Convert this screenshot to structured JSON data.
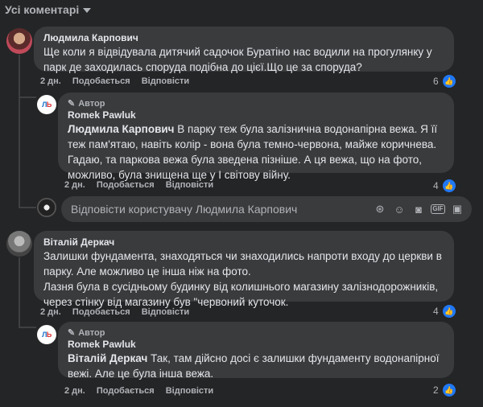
{
  "filter": {
    "label": "Усі коментарі"
  },
  "comments": [
    {
      "author": "Людмила Карпович",
      "text": "Ще коли я відвідувала дитячий садочок Буратіно нас водили на прогулянку у парк де заходилась споруда подібна до цієї.Що це за споруда?",
      "time": "2 дн.",
      "like": "Подобається",
      "reply": "Відповісти",
      "likes": "6"
    },
    {
      "author_badge": "Автор",
      "author": "Romek Pawluk",
      "mention": "Людмила Карпович",
      "text": " В парку теж була залізнична водонапірна вежа. Я її теж пам'ятаю, навіть колір - вона була темно-червона, майже коричнева.",
      "text2": "Гадаю, та паркова вежа була зведена пізніше. А ця вежа, що на фото, можливо, була знищена ще у І світову війну.",
      "time": "2 дн.",
      "like": "Подобається",
      "reply": "Відповісти",
      "likes": "4"
    },
    {
      "author": "Віталій Деркач",
      "text": "Залишки фундамента, знаходяться чи знаходились напроти входу до церкви в парку. Але можливо це інша ніж на фото.",
      "text2": "Лазня була в сусідньому будинку від колишнього магазину залізнодорожників, через стінку від магазину був \"червоний куточок.",
      "time": "2 дн.",
      "like": "Подобається",
      "reply": "Відповісти",
      "likes": "4"
    },
    {
      "author_badge": "Автор",
      "author": "Romek Pawluk",
      "mention": "Віталій Деркач",
      "text": " Так, там дійсно досі є залишки фундаменту водонапірної вежі. Але це була інша вежа.",
      "time": "2 дн.",
      "like": "Подобається",
      "reply": "Відповісти",
      "likes": "2"
    }
  ],
  "reply_box": {
    "placeholder": "Відповісти користувачу Людмила Карпович"
  },
  "icons": [
    "sticker-icon",
    "emoji-icon",
    "camera-icon",
    "gif-icon",
    "sticker-square-icon",
    "like-icon",
    "pencil-icon"
  ],
  "colors": {
    "background": "#242526",
    "bubble": "#3a3b3c",
    "like": "#2078f4"
  }
}
